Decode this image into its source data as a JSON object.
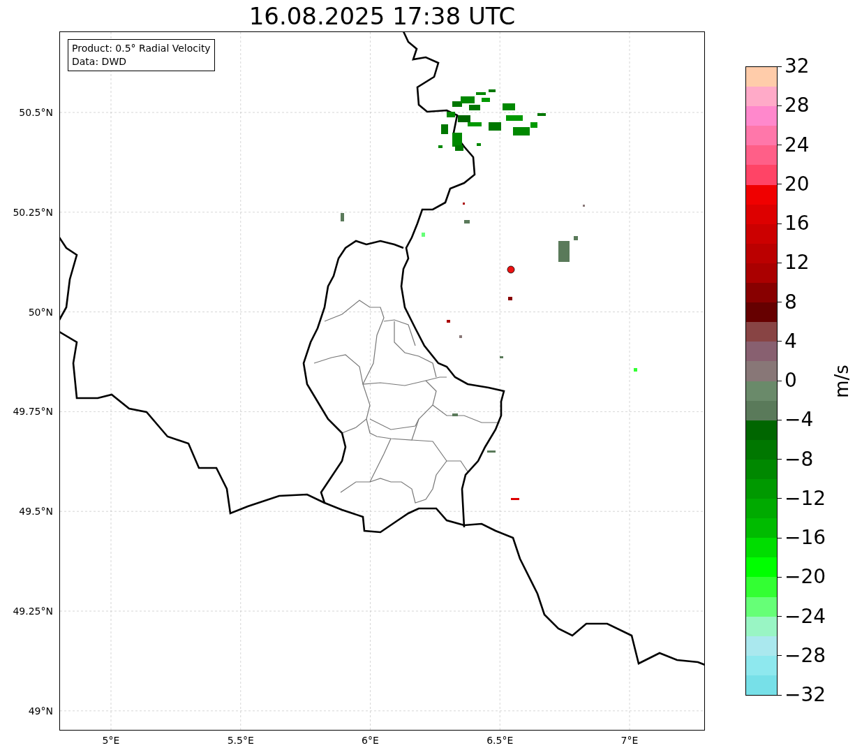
{
  "title": "16.08.2025 17:38 UTC",
  "info_box": {
    "lines": [
      "Product: 0.5° Radial Velocity",
      "Data: DWD"
    ]
  },
  "map": {
    "x_ticks": [
      "5°E",
      "5.5°E",
      "6°E",
      "6.5°E",
      "7°E"
    ],
    "y_ticks": [
      "50.5°N",
      "50.25°N",
      "50°N",
      "49.75°N",
      "49.5°N",
      "49.25°N",
      "49°N"
    ]
  },
  "colorbar": {
    "label": "m/s",
    "ticks": [
      "32",
      "28",
      "24",
      "20",
      "16",
      "12",
      "8",
      "4",
      "0",
      "−4",
      "−8",
      "−12",
      "−16",
      "−20",
      "−24",
      "−28",
      "−32"
    ],
    "bands": [
      {
        "color": "#ffccaa"
      },
      {
        "color": "#ffaac8"
      },
      {
        "color": "#ff88cc"
      },
      {
        "color": "#ff77aa"
      },
      {
        "color": "#ff5f88"
      },
      {
        "color": "#ff4466"
      },
      {
        "color": "#f00000"
      },
      {
        "color": "#dd0000"
      },
      {
        "color": "#cc0000"
      },
      {
        "color": "#bb0000"
      },
      {
        "color": "#aa0000"
      },
      {
        "color": "#880000"
      },
      {
        "color": "#660000"
      },
      {
        "color": "#884444"
      },
      {
        "color": "#886070"
      },
      {
        "color": "#887777"
      },
      {
        "color": "#6a8a6a"
      },
      {
        "color": "#5a7a5a"
      },
      {
        "color": "#006600"
      },
      {
        "color": "#007700"
      },
      {
        "color": "#008800"
      },
      {
        "color": "#009900"
      },
      {
        "color": "#00aa00"
      },
      {
        "color": "#00bb00"
      },
      {
        "color": "#00dd00"
      },
      {
        "color": "#00ff00"
      },
      {
        "color": "#33ff33"
      },
      {
        "color": "#66ff77"
      },
      {
        "color": "#99f5c4"
      },
      {
        "color": "#aae8ee"
      },
      {
        "color": "#8ee8ee"
      },
      {
        "color": "#77e0e8"
      }
    ]
  }
}
